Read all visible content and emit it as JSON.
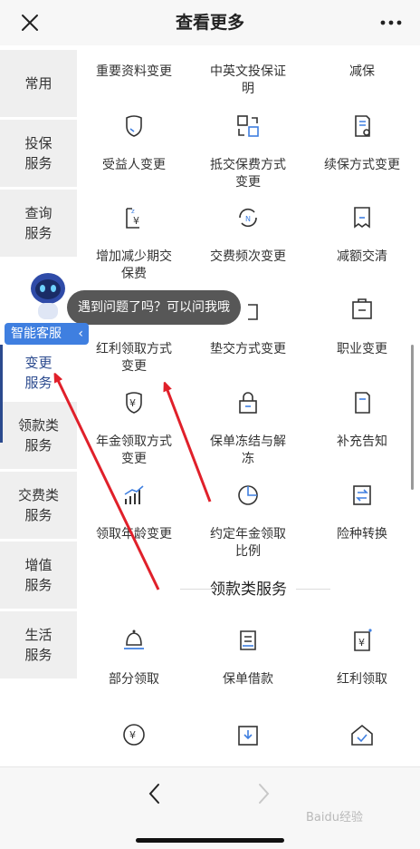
{
  "header": {
    "title": "查看更多"
  },
  "nav": {
    "items": [
      {
        "label": "常用"
      },
      {
        "label": "投保\n服务"
      },
      {
        "label": "查询\n服务"
      },
      {
        "label": "变更\n服务"
      },
      {
        "label": "领款类\n服务"
      },
      {
        "label": "交费类\n服务"
      },
      {
        "label": "增值\n服务"
      },
      {
        "label": "生活\n服务"
      }
    ]
  },
  "grid": {
    "items": [
      {
        "label": "重要资料变更",
        "icon": "document-edit-icon"
      },
      {
        "label": "中英文投保证\n明",
        "icon": "certificate-icon"
      },
      {
        "label": "减保",
        "icon": "reduce-coverage-icon"
      },
      {
        "label": "受益人变更",
        "icon": "shield-person-icon"
      },
      {
        "label": "抵交保费方式\n变更",
        "icon": "swap-boxes-icon"
      },
      {
        "label": "续保方式变更",
        "icon": "renew-document-icon"
      },
      {
        "label": "增加减少期交\n保费",
        "icon": "premium-adjust-icon"
      },
      {
        "label": "交费频次变更",
        "icon": "frequency-cycle-icon"
      },
      {
        "label": "减额交清",
        "icon": "paid-up-document-icon"
      },
      {
        "label": "",
        "icon": "hidden-icon"
      },
      {
        "label": "",
        "icon": "puzzle-icon"
      },
      {
        "label": "",
        "icon": "briefcase-top-icon"
      },
      {
        "label": "红利领取方式\n变更",
        "icon": "bonus-change-icon"
      },
      {
        "label": "垫交方式变更",
        "icon": "advance-pay-icon"
      },
      {
        "label": "职业变更",
        "icon": "briefcase-icon"
      },
      {
        "label": "年金领取方式\n变更",
        "icon": "annuity-shield-icon"
      },
      {
        "label": "保单冻结与解\n冻",
        "icon": "lock-icon"
      },
      {
        "label": "补充告知",
        "icon": "notice-document-icon"
      },
      {
        "label": "领取年龄变更",
        "icon": "bar-chart-icon"
      },
      {
        "label": "约定年金领取\n比例",
        "icon": "pie-chart-icon"
      },
      {
        "label": "险种转换",
        "icon": "convert-document-icon"
      }
    ]
  },
  "section2": {
    "title": "领款类服务",
    "items": [
      {
        "label": "部分领取",
        "icon": "bell-tray-icon"
      },
      {
        "label": "保单借款",
        "icon": "loan-document-icon"
      },
      {
        "label": "红利领取",
        "icon": "yuan-document-icon"
      },
      {
        "label": "",
        "icon": "yuan-circle-icon"
      },
      {
        "label": "",
        "icon": "download-box-icon"
      },
      {
        "label": "",
        "icon": "home-check-icon"
      }
    ]
  },
  "assistant": {
    "bubble": "遇到问题了吗？可以问我哦",
    "badge": "智能客服",
    "badge_chevron": "‹"
  },
  "footer": {
    "watermark": "Baidu经验"
  },
  "colors": {
    "accent": "#2b4a8e",
    "annotation": "#e0202a",
    "badge": "#3f7fe0"
  }
}
